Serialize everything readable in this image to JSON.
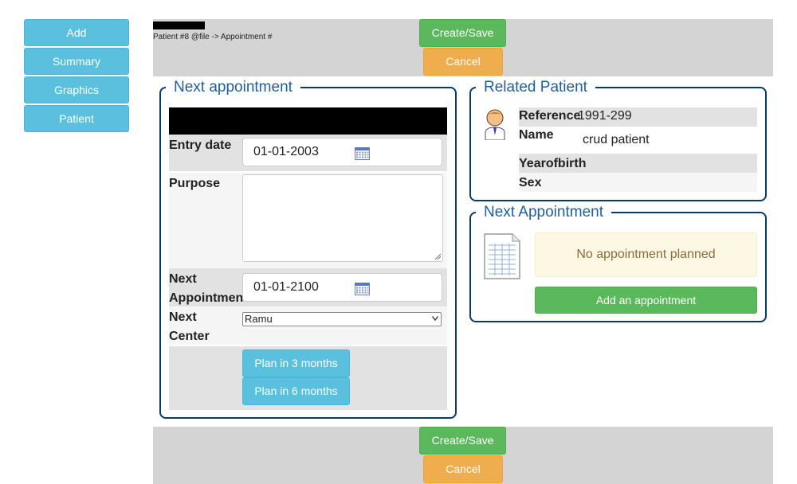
{
  "nav": {
    "add": "Add",
    "summary": "Summary",
    "graphics": "Graphics",
    "patient": "Patient"
  },
  "header": {
    "breadcrumb": "Patient #8 @file -> Appointment #",
    "create_save": "Create/Save",
    "cancel": "Cancel"
  },
  "form": {
    "legend": "Next appointment",
    "entry_date_label": "Entry date",
    "entry_date_value": "01-01-2003",
    "purpose_label": "Purpose",
    "purpose_value": "",
    "next_appointment_label_1": "Next",
    "next_appointment_label_2": "Appointmen",
    "next_appointment_value": "01-01-2100",
    "next_center_label_1": "Next",
    "next_center_label_2": "Center",
    "next_center_selected": "Ramu",
    "plan_3_months": "Plan in 3 months",
    "plan_6_months": "Plan in 6 months"
  },
  "related_patient": {
    "legend": "Related Patient",
    "reference_label": "Reference",
    "reference_value": "1991-299",
    "name_label": "Name",
    "name_value": "crud patient",
    "yearofbirth_label": "Yearofbirth",
    "yearofbirth_value": "",
    "sex_label": "Sex",
    "sex_value": ""
  },
  "next_appointment": {
    "legend": "Next Appointment",
    "message": "No appointment planned",
    "add_button": "Add an appointment"
  },
  "footer": {
    "create_save": "Create/Save",
    "cancel": "Cancel"
  },
  "colors": {
    "info_blue": "#5bc0de",
    "success_green": "#5cb85c",
    "warning_orange": "#f0ad4e",
    "legend_blue": "#1f5f9a",
    "fieldset_border": "#0b3a66",
    "band_grey": "#d4d4d4",
    "alert_bg": "#fcf8e3"
  },
  "icons": {
    "calendar": "calendar-icon",
    "patient": "patient-avatar-icon",
    "document": "document-icon"
  }
}
